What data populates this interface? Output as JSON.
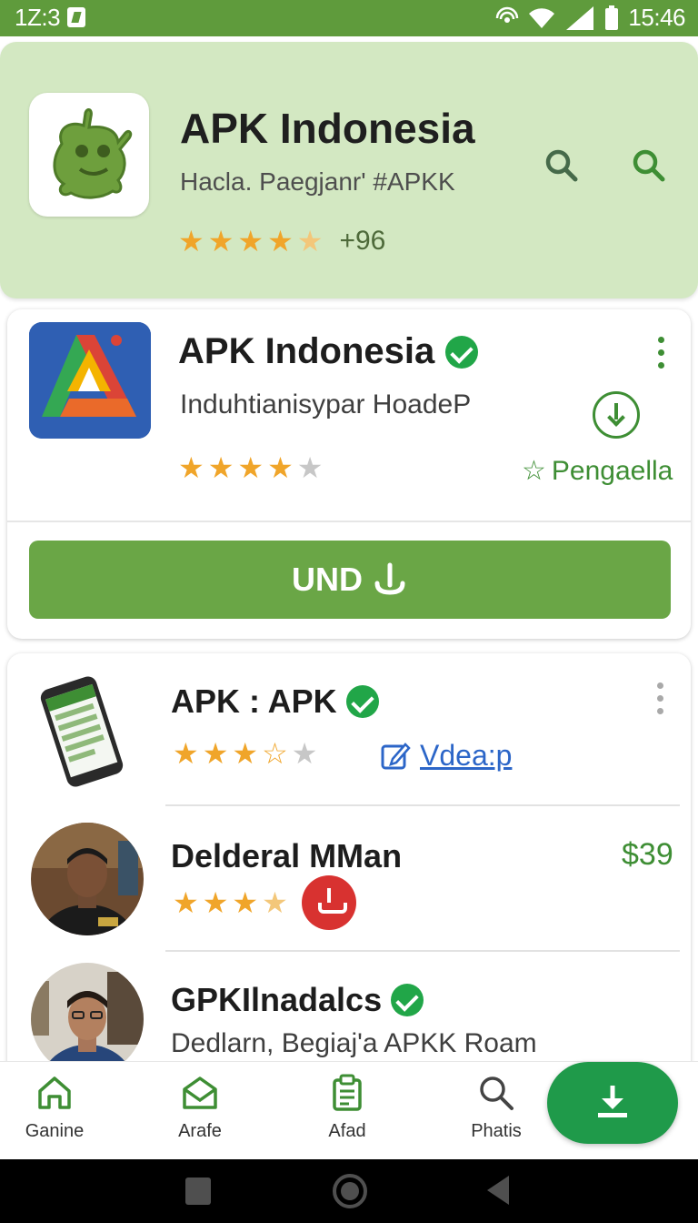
{
  "status_bar": {
    "left_time": "1Z:3",
    "right_time": "15:46"
  },
  "header": {
    "title": "APK Indonesia",
    "subtitle": "Hacla. Paegjanr' #APKK",
    "rating_stars": 4.5,
    "rating_count": "+96",
    "icons": [
      "search-icon",
      "search-icon"
    ]
  },
  "featured": {
    "title": "APK Indonesia",
    "subtitle": "Induhtianisypar HoadeP",
    "rating_stars": 4,
    "favorite_label": "Pengaella",
    "button_label": "UND",
    "icons": [
      "verified-badge-icon",
      "more-vert-icon",
      "download-circle-icon",
      "star-outline-icon",
      "download-icon"
    ]
  },
  "list": {
    "items": [
      {
        "title": "APK : APK",
        "rating_stars": 3,
        "link_label": "Vdea:p",
        "icons": [
          "verified-badge-icon",
          "more-vert-icon",
          "edit-icon"
        ]
      },
      {
        "title": "Delderal MMan",
        "rating_stars": 4,
        "price": "$39",
        "icons": [
          "download-icon"
        ]
      },
      {
        "title": "GPKIlnadalcs",
        "subtitle": "Dedlarn, Begiaj'a APKK Roam",
        "icons": [
          "verified-badge-icon"
        ]
      }
    ]
  },
  "bottom_nav": {
    "items": [
      {
        "label": "Ganine",
        "icon": "home-icon"
      },
      {
        "label": "Arafe",
        "icon": "mail-icon"
      },
      {
        "label": "Afad",
        "icon": "clipboard-icon"
      },
      {
        "label": "Phatis",
        "icon": "search-icon"
      }
    ],
    "fab_icon": "download-icon"
  },
  "colors": {
    "status_bar": "#5f9b3c",
    "header_bg": "#d3e8c2",
    "primary_button": "#6aa646",
    "accent_green": "#3e8e34",
    "fab": "#1f9a4a",
    "star": "#f0a52a",
    "verified": "#21a648",
    "link": "#2c66c8",
    "danger": "#d83230"
  }
}
